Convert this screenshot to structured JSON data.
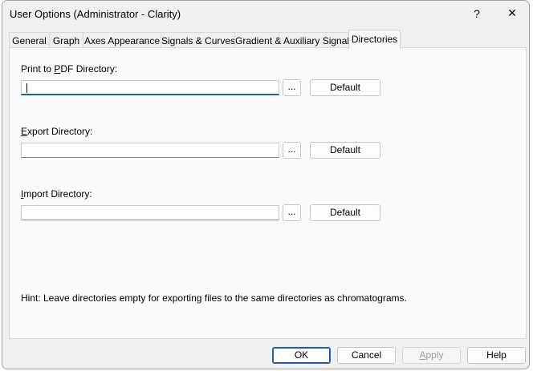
{
  "window": {
    "title": "User Options (Administrator - Clarity)",
    "help_glyph": "?",
    "close_glyph": "✕"
  },
  "tabs": [
    {
      "label": "General"
    },
    {
      "label": "Graph"
    },
    {
      "label": "Axes Appearance"
    },
    {
      "label": "Signals & Curves"
    },
    {
      "label": "Gradient & Auxiliary Signals"
    },
    {
      "label": "Directories",
      "active": true
    }
  ],
  "directories": {
    "print_pdf": {
      "label_pre": "Print to ",
      "label_key": "P",
      "label_post": "DF Directory:",
      "value": "",
      "browse": "...",
      "default": "Default"
    },
    "export": {
      "label_pre": "",
      "label_key": "E",
      "label_post": "xport Directory:",
      "value": "",
      "browse": "...",
      "default": "Default"
    },
    "import": {
      "label_pre": "",
      "label_key": "I",
      "label_post": "mport Directory:",
      "value": "",
      "browse": "...",
      "default": "Default"
    },
    "hint": "Hint: Leave directories empty for exporting files to the same directories as chromatograms."
  },
  "buttons": {
    "ok": "OK",
    "cancel": "Cancel",
    "apply_key": "A",
    "apply_rest": "pply",
    "help": "Help"
  }
}
